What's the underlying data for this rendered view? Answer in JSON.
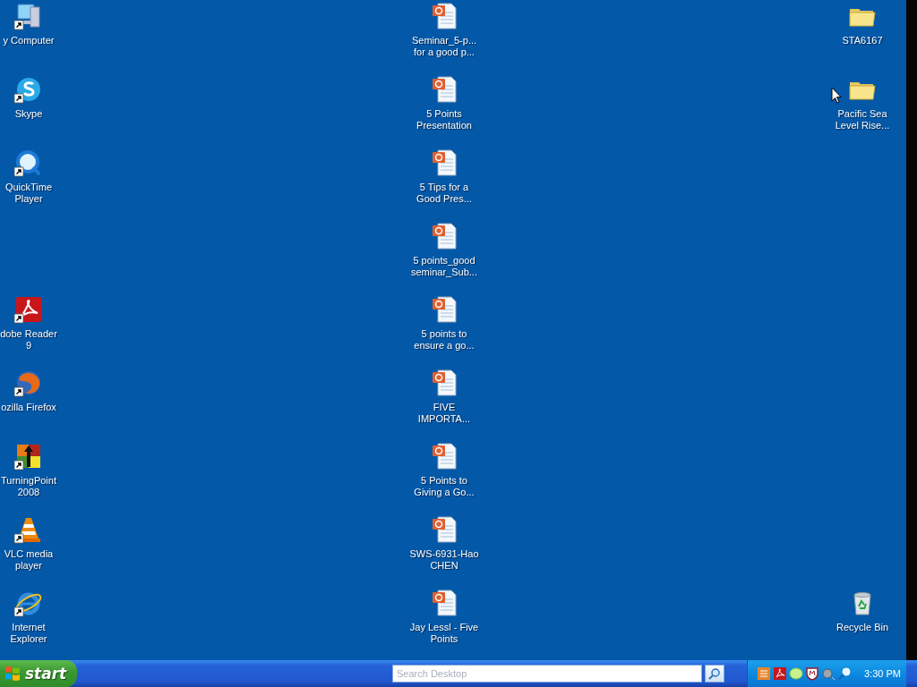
{
  "desktop": {
    "columns": [
      {
        "top": [
          {
            "label": "y Computer",
            "kind": "computer",
            "shortcut": true
          },
          {
            "label": "Skype",
            "kind": "skype",
            "shortcut": true
          },
          {
            "label": "QuickTime Player",
            "kind": "quicktime",
            "shortcut": true
          }
        ],
        "bottom": [
          {
            "label": "dobe Reader 9",
            "kind": "pdf",
            "shortcut": true
          },
          {
            "label": "ozilla Firefox",
            "kind": "firefox",
            "shortcut": true
          },
          {
            "label": "TurningPoint 2008",
            "kind": "clicker",
            "shortcut": true
          },
          {
            "label": "VLC media player",
            "kind": "cone",
            "shortcut": true
          },
          {
            "label": "Internet Explorer",
            "kind": "ie",
            "shortcut": true
          }
        ]
      },
      {
        "top": [
          {
            "label": "Seminar_5-p... for a good p...",
            "kind": "presentation",
            "shortcut": false
          },
          {
            "label": "5 Points Presentation",
            "kind": "presentation",
            "shortcut": false
          },
          {
            "label": "5 Tips for a Good Pres...",
            "kind": "presentation",
            "shortcut": false
          },
          {
            "label": "5 points_good seminar_Sub...",
            "kind": "presentation",
            "shortcut": false
          },
          {
            "label": "5 points to ensure a go...",
            "kind": "presentation",
            "shortcut": false
          },
          {
            "label": "FIVE IMPORTA...",
            "kind": "presentation",
            "shortcut": false
          },
          {
            "label": "5 Points to Giving a Go...",
            "kind": "presentation",
            "shortcut": false
          },
          {
            "label": "SWS-6931-Hao CHEN",
            "kind": "presentation",
            "shortcut": false
          },
          {
            "label": "Jay Lessl - Five Points",
            "kind": "presentation",
            "shortcut": false
          }
        ]
      },
      {
        "top": [
          {
            "label": "STA6167",
            "kind": "folder",
            "shortcut": false
          },
          {
            "label": "Pacific Sea Level Rise...",
            "kind": "folder",
            "shortcut": false
          }
        ],
        "bottom": [
          {
            "label": "Recycle Bin",
            "kind": "recycle",
            "shortcut": false
          }
        ]
      }
    ]
  },
  "taskbar": {
    "start": "start",
    "search": {
      "placeholder": "Search Desktop"
    },
    "clock": "3:30 PM"
  }
}
